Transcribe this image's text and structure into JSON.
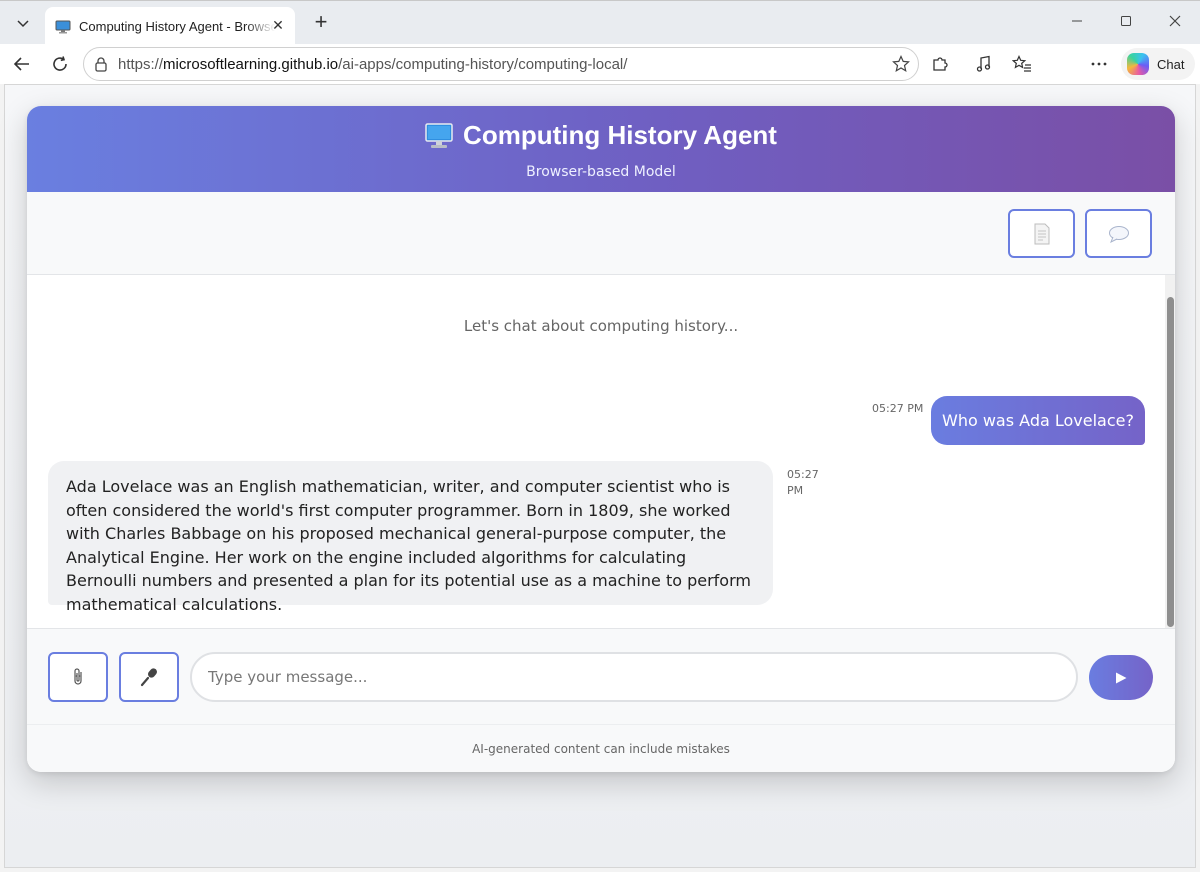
{
  "browser": {
    "tab_title": "Computing History Agent - Browser-based Model",
    "url_prefix": "https://",
    "url_host": "microsoftlearning.github.io",
    "url_path": "/ai-apps/computing-history/computing-local/",
    "chat_label": "Chat"
  },
  "app": {
    "title": "Computing History Agent",
    "subtitle": "Browser-based Model",
    "accent_color": "#6a7ee0"
  },
  "chat": {
    "intro": "Let's chat about computing history...",
    "messages": [
      {
        "role": "user",
        "text": "Who was Ada Lovelace?",
        "time": "05:27 PM"
      },
      {
        "role": "assistant",
        "text": "Ada Lovelace was an English mathematician, writer, and computer scientist who is often considered the world's first computer programmer. Born in 1809, she worked with Charles Babbage on his proposed mechanical general-purpose computer, the Analytical Engine. Her work on the engine included algorithms for calculating Bernoulli numbers and presented a plan for its potential use as a machine to perform mathematical calculations.",
        "time": "05:27 PM"
      }
    ]
  },
  "input": {
    "placeholder": "Type your message...",
    "value": ""
  },
  "footer": {
    "disclaimer": "AI-generated content can include mistakes"
  }
}
